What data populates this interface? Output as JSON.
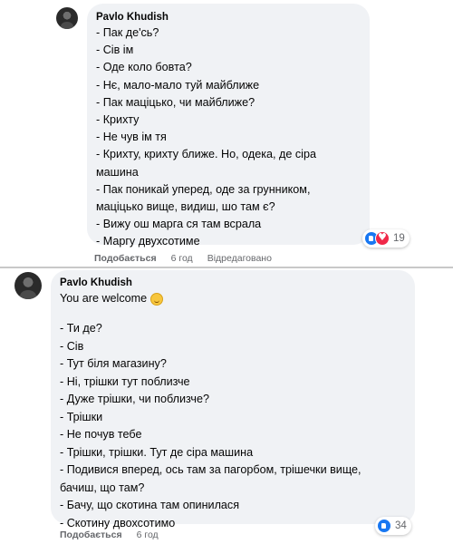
{
  "comment1": {
    "author": "Pavlo Khudish",
    "lines": [
      "- Пак де'сь?",
      "- Сів ім",
      "- Оде коло бовта?",
      "- Нє, мало-мало туй майближе",
      "- Пак маціцько, чи майближе?",
      "- Крихту",
      "- Не чув ім тя",
      "- Крихту, крихту ближе. Но, одека, де сіра",
      "машина",
      "- Пак поникай уперед, оде за грунником,",
      "маціцько вище, видиш, шо там є?",
      "- Вижу ош марга ся там всрала",
      "- Маргу двухсотиме"
    ],
    "reaction_count": "19",
    "like_label": "Подобається",
    "time": "6 год",
    "edited": "Відредаговано"
  },
  "comment2": {
    "author": "Pavlo Khudish",
    "greeting": "You are welcome",
    "lines": [
      "- Ти де?",
      "- Сів",
      "- Тут біля магазину?",
      "- Ні, трішки тут поблизче",
      "- Дуже трішки, чи поблизче?",
      "- Трішки",
      "- Не почув тебе",
      "- Трішки, трішки. Тут де сіра машина",
      "- Подивися вперед, ось там за пагорбом, трішечки вище,",
      "бачиш, що там?",
      "- Бачу, що скотина там опинилася",
      "- Скотину двохсотимо"
    ],
    "reaction_count": "34",
    "like_label": "Подобається",
    "time": "6 год"
  },
  "icons": {
    "like": "like-reaction-icon",
    "love": "love-reaction-icon",
    "smile": "grinning-emoji-icon"
  },
  "colors": {
    "bubble": "#f0f2f5",
    "like_blue": "#1877f2",
    "love_red": "#f02849",
    "meta_gray": "#65676b"
  }
}
